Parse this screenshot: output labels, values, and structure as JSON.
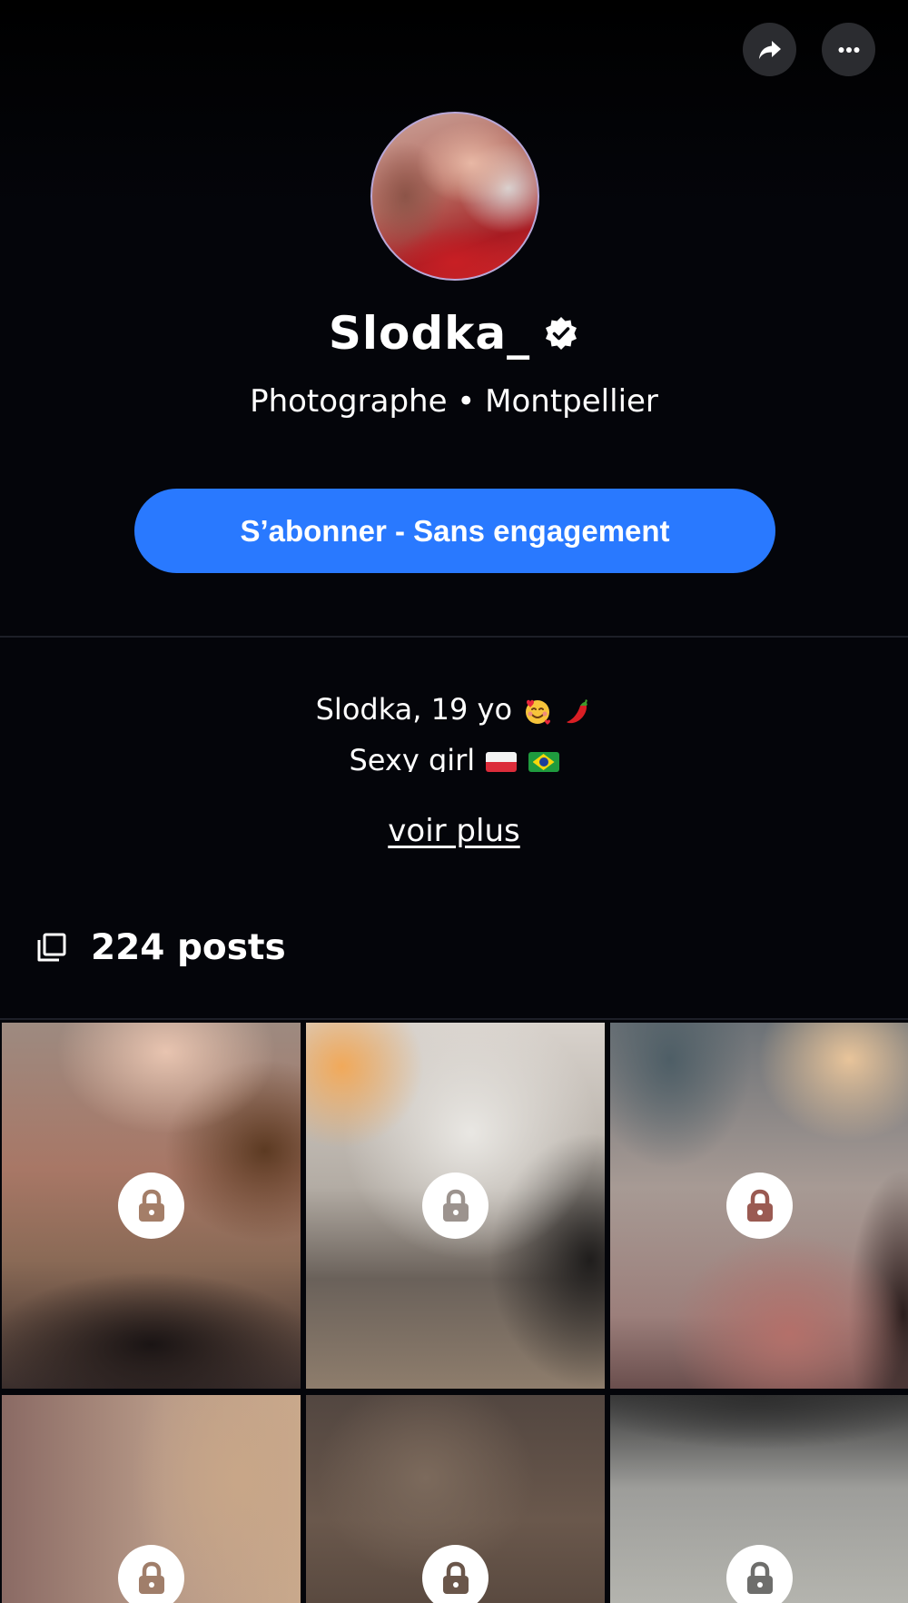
{
  "colors": {
    "background": "#04050a",
    "accent": "#2979ff",
    "icon_button_bg": "#2b2c30",
    "text": "#ffffff"
  },
  "header": {
    "share_icon": "share-arrow-icon",
    "more_icon": "more-dots-icon"
  },
  "profile": {
    "name": "Slodka_",
    "verified_icon": "verified-badge-icon",
    "subtitle": "Photographe • Montpellier",
    "subscribe_label": "S’abonner - Sans engagement"
  },
  "bio": {
    "line1": "Slodka, 19 yo",
    "line1_emojis": [
      "smiling-face-with-hearts-icon",
      "hot-pepper-icon"
    ],
    "line2": "Sexy girl",
    "line2_flags": [
      "poland-flag-icon",
      "brazil-flag-icon"
    ],
    "see_more": "voir plus"
  },
  "posts": {
    "icon": "posts-stack-icon",
    "count_label": "224 posts"
  },
  "grid": {
    "tiles": [
      {
        "locked": true,
        "icon": "lock-icon"
      },
      {
        "locked": true,
        "icon": "lock-icon"
      },
      {
        "locked": true,
        "icon": "lock-icon"
      },
      {
        "locked": true,
        "icon": "lock-icon"
      },
      {
        "locked": true,
        "icon": "lock-icon"
      },
      {
        "locked": true,
        "icon": "lock-icon"
      }
    ]
  }
}
